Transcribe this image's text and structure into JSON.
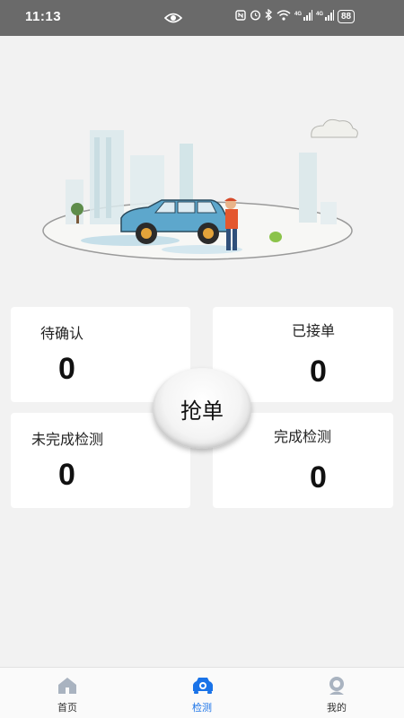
{
  "status_bar": {
    "time": "11:13",
    "battery": "88",
    "network": "4G"
  },
  "cards": {
    "pending": {
      "label": "待确认",
      "count": "0"
    },
    "accepted": {
      "label": "已接单",
      "count": "0"
    },
    "incomplete": {
      "label": "未完成检测",
      "count": "0"
    },
    "complete": {
      "label": "完成检测",
      "count": "0"
    }
  },
  "grab_button": {
    "label": "抢单"
  },
  "tabbar": {
    "items": [
      {
        "label": "首页",
        "icon": "home-icon",
        "active": false
      },
      {
        "label": "检测",
        "icon": "inspect-car-icon",
        "active": true
      },
      {
        "label": "我的",
        "icon": "profile-icon",
        "active": false
      }
    ]
  },
  "colors": {
    "accent": "#1a73e8",
    "inactive_icon": "#a9b3c0",
    "status_bar": "#6a6a6a"
  }
}
